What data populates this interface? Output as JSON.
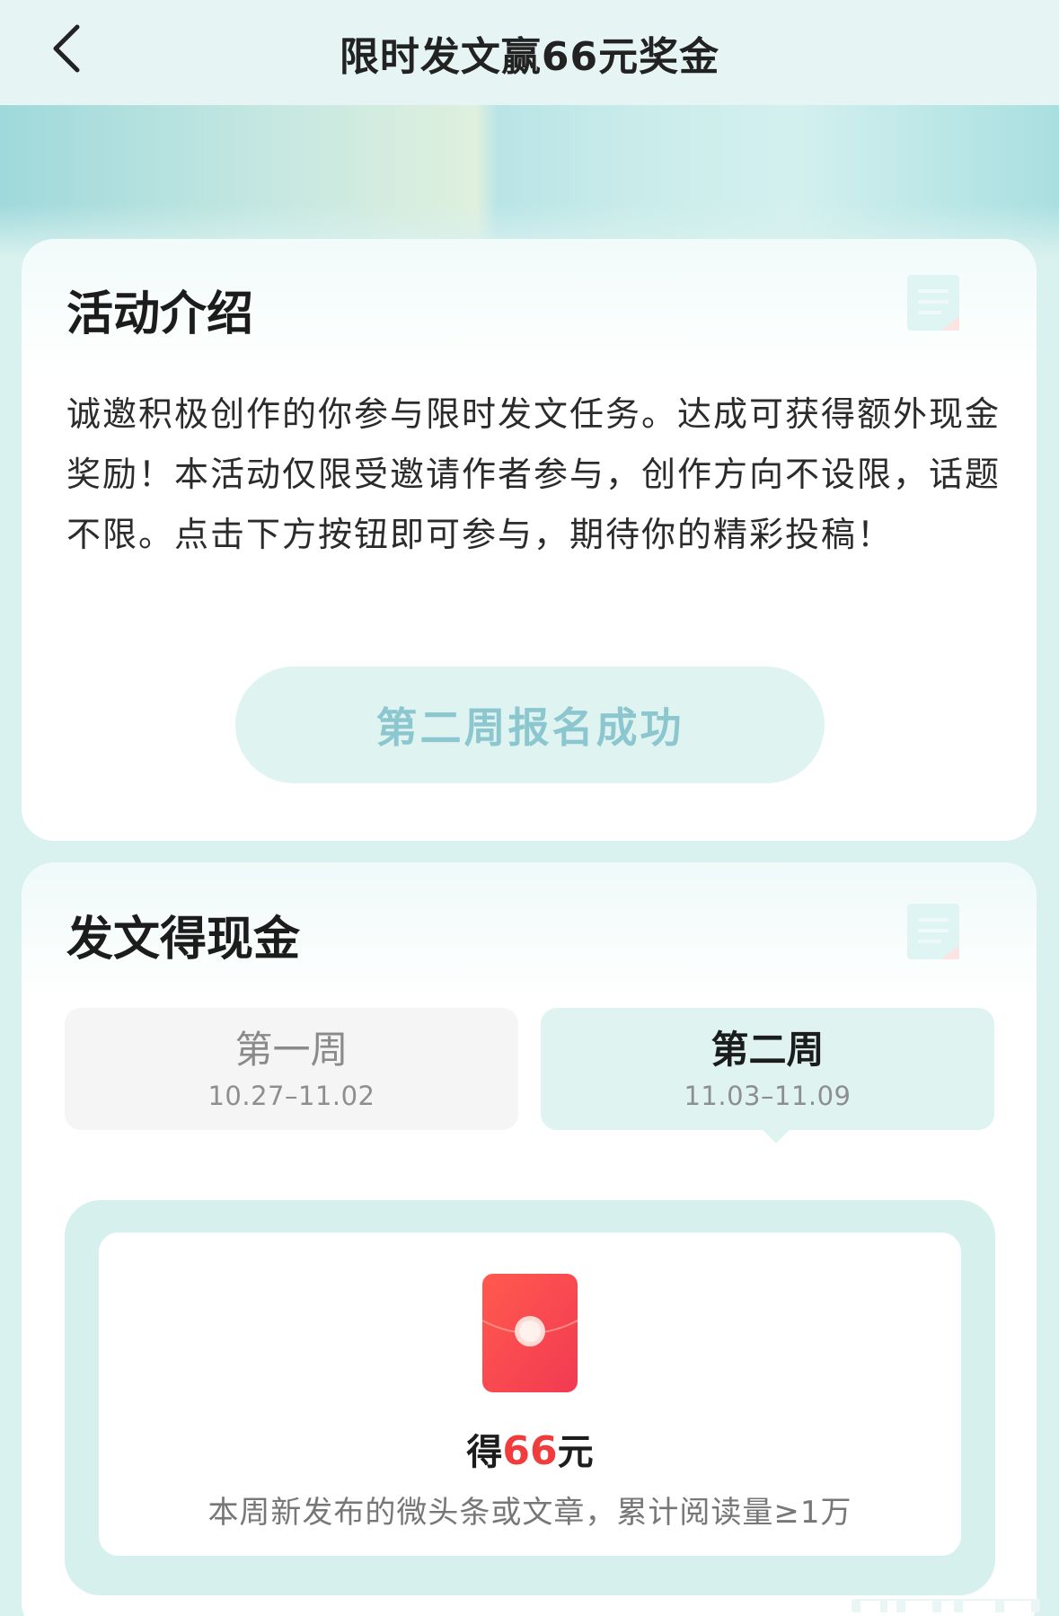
{
  "nav": {
    "title": "限时发文赢66元奖金",
    "back_icon": "chevron-left-icon"
  },
  "intro": {
    "title": "活动介绍",
    "text": "诚邀积极创作的你参与限时发文任务。达成可获得额外现金奖励！本活动仅限受邀请作者参与，创作方向不设限，话题不限。点击下方按钮即可参与，期待你的精彩投稿！",
    "button_label": "第二周报名成功"
  },
  "cash": {
    "title": "发文得现金",
    "weeks": [
      {
        "name": "第一周",
        "date": "10.27–11.02",
        "selected": false
      },
      {
        "name": "第二周",
        "date": "11.03–11.09",
        "selected": true
      }
    ],
    "reward": {
      "prefix": "得",
      "amount": "66",
      "suffix": "元",
      "description": "本周新发布的微头条或文章，累计阅读量≥1万",
      "icon": "red-envelope-icon"
    }
  },
  "colors": {
    "accent_teal": "#dff3f1",
    "button_text": "#8cc6ce",
    "highlight": "#b8ecec",
    "reward_red": "#f03c3c"
  }
}
